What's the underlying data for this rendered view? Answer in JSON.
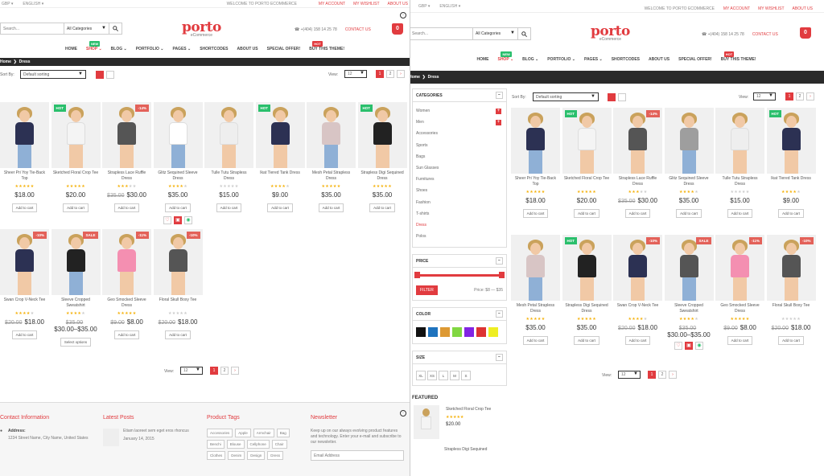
{
  "topbar": {
    "currency": "GBP",
    "language": "ENGLISH",
    "welcome": "WELCOME TO PORTO ECOMMERCE",
    "my_account": "MY ACCOUNT",
    "wishlist": "MY WISHLIST",
    "about": "ABOUT US"
  },
  "header": {
    "search_placeholder": "Search...",
    "category": "All Categories",
    "logo": "porto",
    "logo_sub": "eCommerce",
    "phone": "+(404) 158 14 25 78",
    "contact": "CONTACT US",
    "cart_count": "0"
  },
  "nav": [
    {
      "label": "HOME",
      "tag": ""
    },
    {
      "label": "SHOP",
      "tag": "NEW"
    },
    {
      "label": "BLOG",
      "tag": ""
    },
    {
      "label": "PORTFOLIO",
      "tag": ""
    },
    {
      "label": "PAGES",
      "tag": ""
    },
    {
      "label": "SHORTCODES",
      "tag": ""
    },
    {
      "label": "ABOUT US",
      "tag": ""
    },
    {
      "label": "SPECIAL OFFER!",
      "tag": ""
    },
    {
      "label": "BUY THIS THEME!",
      "tag": "HOT"
    }
  ],
  "breadcrumb": {
    "home": "Home",
    "current": "Dress"
  },
  "toolbar": {
    "sort_label": "Sort By:",
    "sort_value": "Default sorting",
    "view_label": "View:",
    "view_value": "12",
    "pages": [
      "1",
      "2"
    ],
    "next": "›"
  },
  "products": [
    {
      "name": "Sheer Pri Yoy Tie-Back Top",
      "badge": "",
      "rating": 5,
      "old": "",
      "price": "$18.00",
      "action": "Add to cart",
      "shirt": "#2c3153"
    },
    {
      "name": "Sketched Floral Crop Tee",
      "badge": "HOT",
      "rating": 5,
      "old": "",
      "price": "$20.00",
      "action": "Add to cart",
      "shirt": "#f4f4f4"
    },
    {
      "name": "Strapless Lace Ruffle Dress",
      "badge": "-14%",
      "rating": 3,
      "old": "$35.00",
      "price": "$30.00",
      "action": "Add to cart",
      "shirt": "#555555"
    },
    {
      "name": "Glitz Sequined Sleeve Dress",
      "badge": "",
      "rating": 4,
      "old": "",
      "price": "$35.00",
      "action": "Add to cart",
      "shirt": "#ffffff"
    },
    {
      "name": "Tulle Tutu Strapless Dress",
      "badge": "",
      "rating": 0,
      "old": "",
      "price": "$15.00",
      "action": "Add to cart",
      "shirt": "#eeeeee"
    },
    {
      "name": "Ikat Tiered Tank Dress",
      "badge": "HOT",
      "rating": 4,
      "old": "",
      "price": "$9.00",
      "action": "Add to cart",
      "shirt": "#2c3153"
    },
    {
      "name": "Mesh Petal Strapless Dress",
      "badge": "",
      "rating": 5,
      "old": "",
      "price": "$35.00",
      "action": "Add to cart",
      "shirt": "#d8c5c5"
    },
    {
      "name": "Strapless Digi Sequined Dress",
      "badge": "HOT",
      "rating": 5,
      "old": "",
      "price": "$35.00",
      "action": "Add to cart",
      "shirt": "#222222"
    },
    {
      "name": "Swan Crop V-Neck Tee",
      "badge": "-10%",
      "rating": 4,
      "old": "$20.00",
      "price": "$18.00",
      "action": "Add to cart",
      "shirt": "#2c3153"
    },
    {
      "name": "Sleeve Cropped Sweatshirt",
      "badge": "SALE",
      "rating": 4,
      "old": "$35.00",
      "price": "$30.00–$35.00",
      "action": "Select options",
      "shirt": "#222222"
    },
    {
      "name": "Geo Smocked Sleeve Dress",
      "badge": "-11%",
      "rating": 5,
      "old": "$9.00",
      "price": "$8.00",
      "action": "Add to cart",
      "shirt": "#f48fb1"
    },
    {
      "name": "Floral Skull Boxy Tee",
      "badge": "-10%",
      "rating": 0,
      "old": "$20.00",
      "price": "$18.00",
      "action": "Add to cart",
      "shirt": "#555555"
    }
  ],
  "products_right": [
    {
      "name": "Sheer Pri Yoy Tie-Back Top",
      "badge": "",
      "rating": 5,
      "old": "",
      "price": "$18.00",
      "action": "Add to cart",
      "shirt": "#2c3153"
    },
    {
      "name": "Sketched Floral Crop Tee",
      "badge": "HOT",
      "rating": 5,
      "old": "",
      "price": "$20.00",
      "action": "Add to cart",
      "shirt": "#f4f4f4"
    },
    {
      "name": "Strapless Lace Ruffle Dress",
      "badge": "-14%",
      "rating": 3,
      "old": "$35.00",
      "price": "$30.00",
      "action": "Add to cart",
      "shirt": "#555555"
    },
    {
      "name": "Glitz Sequined Sleeve Dress",
      "badge": "",
      "rating": 4,
      "old": "",
      "price": "$35.00",
      "action": "Add to cart",
      "shirt": "#9e9e9e"
    },
    {
      "name": "Tulle Tutu Strapless Dress",
      "badge": "",
      "rating": 0,
      "old": "",
      "price": "$15.00",
      "action": "Add to cart",
      "shirt": "#eeeeee"
    },
    {
      "name": "Ikat Tiered Tank Dress",
      "badge": "HOT",
      "rating": 4,
      "old": "",
      "price": "$9.00",
      "action": "Add to cart",
      "shirt": "#2c3153"
    },
    {
      "name": "Mesh Petal Strapless Dress",
      "badge": "",
      "rating": 5,
      "old": "",
      "price": "$35.00",
      "action": "Add to cart",
      "shirt": "#d8c5c5"
    },
    {
      "name": "Strapless Digi Sequined Dress",
      "badge": "HOT",
      "rating": 5,
      "old": "",
      "price": "$35.00",
      "action": "Add to cart",
      "shirt": "#222222"
    },
    {
      "name": "Swan Crop V-Neck Tee",
      "badge": "-10%",
      "rating": 4,
      "old": "$20.00",
      "price": "$18.00",
      "action": "Add to cart",
      "shirt": "#2c3153"
    },
    {
      "name": "Sleeve Cropped Sweatshirt",
      "badge": "SALE",
      "rating": 4,
      "old": "$35.00",
      "price": "$30.00–$35.00",
      "action": "",
      "shirt": "#555555"
    },
    {
      "name": "Geo Smocked Sleeve Dress",
      "badge": "-11%",
      "rating": 5,
      "old": "$9.00",
      "price": "$8.00",
      "action": "Add to cart",
      "shirt": "#f48fb1"
    },
    {
      "name": "Floral Skull Boxy Tee",
      "badge": "-10%",
      "rating": 0,
      "old": "$20.00",
      "price": "$18.00",
      "action": "Add to cart",
      "shirt": "#555555"
    }
  ],
  "sidebar": {
    "categories_title": "CATEGORIES",
    "categories": [
      "Women",
      "Men",
      "Accessories",
      "Sports",
      "Bags",
      "Sun Glasses",
      "Furnitures",
      "Shoes",
      "Fashion",
      "T-shirts",
      "Dress",
      "Polos"
    ],
    "price_title": "PRICE",
    "filter": "FILTER",
    "price_range": "Price: $8 — $35",
    "color_title": "COLOR",
    "colors": [
      "#111111",
      "#1e73be",
      "#dd9933",
      "#81d742",
      "#8224e3",
      "#dd3333",
      "#eeee22"
    ],
    "size_title": "SIZE",
    "sizes": [
      "XL",
      "XS",
      "L",
      "M",
      "S"
    ],
    "featured_title": "FEATURED",
    "featured": [
      {
        "name": "Sketched Floral Crop Tee",
        "price": "$20.00"
      },
      {
        "name": "Strapless Digi Sequined"
      }
    ]
  },
  "footer": {
    "contact_title": "Contact Information",
    "address_label": "Address:",
    "address": "1234 Street Name, City Name, United States",
    "posts_title": "Latest Posts",
    "post_text": "Etiam laoreet sem eget eros rhoncus",
    "post_date": "January 14, 2015",
    "tags_title": "Product Tags",
    "tags": [
      "Accessories",
      "Apple",
      "Armchair",
      "Bag",
      "Benchi",
      "Blouse",
      "Cellphone",
      "Chair",
      "Clothes",
      "Denim",
      "Design",
      "Dress"
    ],
    "news_title": "Newsletter",
    "news_text": "Keep up on our always evolving product features and technology. Enter your e-mail and subscribe to our newsletter.",
    "email_placeholder": "Email Address"
  }
}
